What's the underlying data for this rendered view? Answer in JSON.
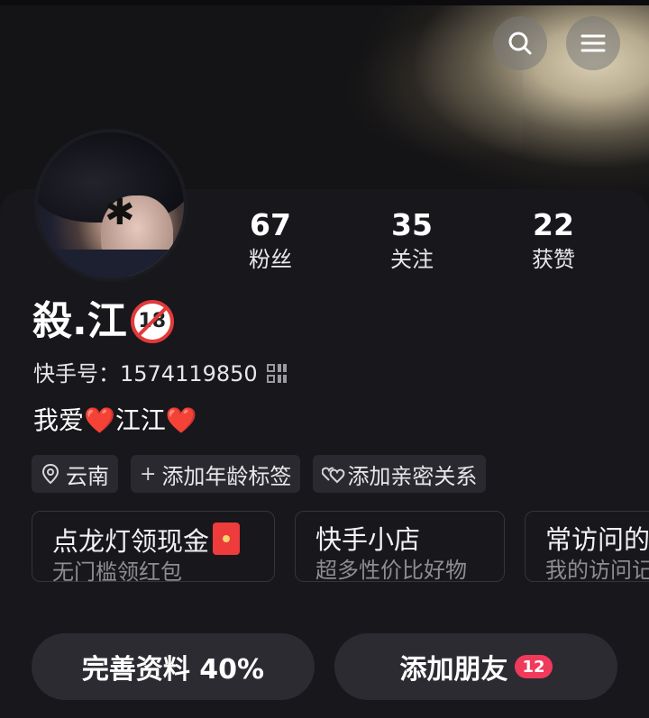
{
  "header": {
    "search_icon": "search-icon",
    "menu_icon": "hamburger-menu-icon"
  },
  "profile": {
    "name": "殺.江",
    "age_badge": "18",
    "kuaishou_id_label": "快手号：",
    "kuaishou_id": "1574119850",
    "bio": "我爱❤️江江❤️"
  },
  "stats": [
    {
      "value": "67",
      "label": "粉丝"
    },
    {
      "value": "35",
      "label": "关注"
    },
    {
      "value": "22",
      "label": "获赞"
    }
  ],
  "tags": [
    {
      "icon": "location-pin-icon",
      "label": "云南",
      "glyph": "⚲"
    },
    {
      "icon": "plus-icon",
      "label": "添加年龄标签",
      "glyph": "+"
    },
    {
      "icon": "hearts-icon",
      "label": "添加亲密关系",
      "glyph": "♡"
    }
  ],
  "feature_cards": [
    {
      "title": "点龙灯领现金",
      "subtitle": "无门槛领红包",
      "icon": "red-packet-icon"
    },
    {
      "title": "快手小店",
      "subtitle": "超多性价比好物"
    },
    {
      "title": "常访问的",
      "subtitle": "我的访问记"
    }
  ],
  "actions": {
    "complete_profile": "完善资料 40%",
    "add_friends": "添加朋友",
    "add_friends_count": "12"
  }
}
